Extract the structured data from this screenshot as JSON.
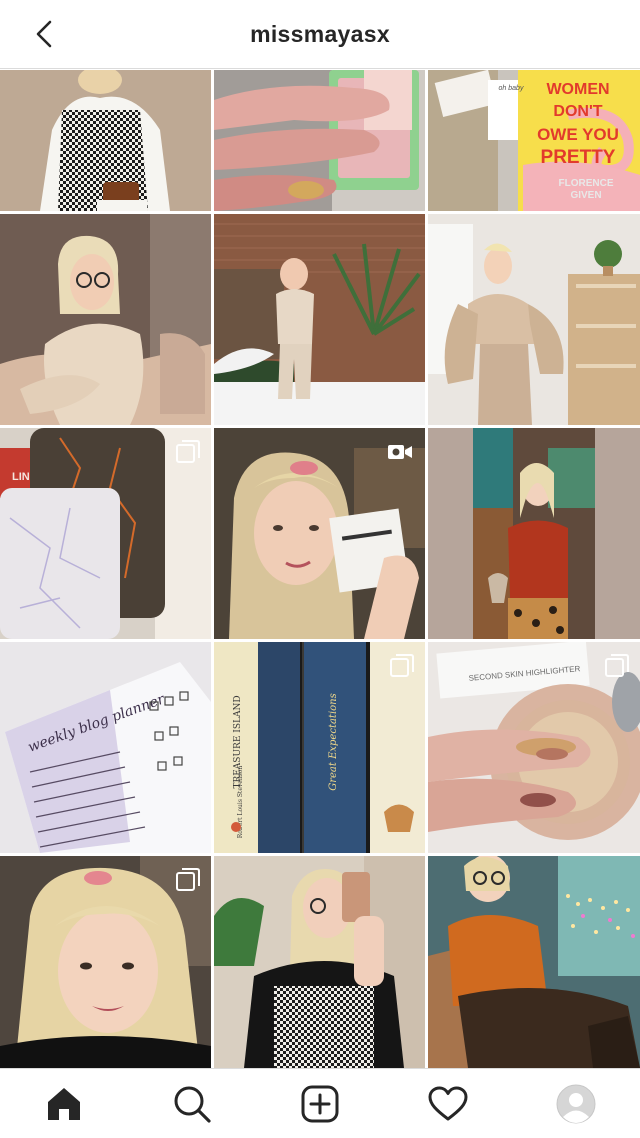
{
  "header": {
    "title": "missmayasx"
  },
  "grid": {
    "tiles": [
      {
        "id": "post-1",
        "badge": null
      },
      {
        "id": "post-2",
        "badge": null
      },
      {
        "id": "post-3",
        "badge": null,
        "book_title": "WOMEN DON'T OWE YOU PRETTY",
        "book_author": "FLORENCE GIVEN",
        "sticker": "oh baby"
      },
      {
        "id": "post-4",
        "badge": null
      },
      {
        "id": "post-5",
        "badge": null
      },
      {
        "id": "post-6",
        "badge": null
      },
      {
        "id": "post-7",
        "badge": "carousel",
        "card_text": "LINS"
      },
      {
        "id": "post-8",
        "badge": "video"
      },
      {
        "id": "post-9",
        "badge": null
      },
      {
        "id": "post-10",
        "badge": null,
        "note_title": "weekly blog planner"
      },
      {
        "id": "post-11",
        "badge": "carousel",
        "spine_titles": [
          "TREASURE ISLAND",
          "Great Expectations"
        ],
        "spine_author": "Robert Louis Stevenson"
      },
      {
        "id": "post-12",
        "badge": "carousel",
        "product_text": "SECOND SKIN HIGHLIGHTER"
      },
      {
        "id": "post-13",
        "badge": "carousel"
      },
      {
        "id": "post-14",
        "badge": null
      },
      {
        "id": "post-15",
        "badge": null
      }
    ]
  },
  "tabbar": {
    "items": [
      {
        "name": "home",
        "active": true
      },
      {
        "name": "search",
        "active": false
      },
      {
        "name": "new-post",
        "active": false
      },
      {
        "name": "activity",
        "active": false
      },
      {
        "name": "profile",
        "active": false
      }
    ]
  }
}
